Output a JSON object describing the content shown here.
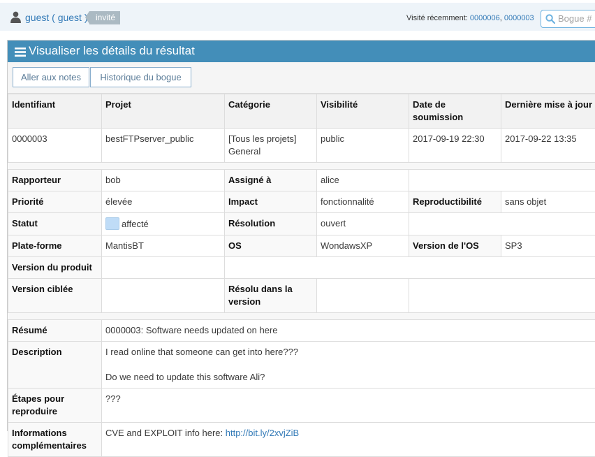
{
  "navbar": {
    "user_label": "guest ( guest )",
    "role_badge": "invité",
    "recent_label": "Visité récemment:",
    "recent_links": [
      "0000006",
      "0000003"
    ],
    "search_placeholder": "Bogue #"
  },
  "widget": {
    "title": "Visualiser les détails du résultat",
    "buttons": {
      "notes": "Aller aux notes",
      "history": "Historique du bogue"
    }
  },
  "summary_table": {
    "headers": [
      "Identifiant",
      "Projet",
      "Catégorie",
      "Visibilité",
      "Date de soumission",
      "Dernière mise à jour"
    ],
    "row": {
      "id": "0000003",
      "project": "bestFTPserver_public",
      "category_line1": "[Tous les projets]",
      "category_line2": "General",
      "visibility": "public",
      "submitted": "2017-09-19 22:30",
      "updated": "2017-09-22 13:35"
    }
  },
  "fields": {
    "reporter_label": "Rapporteur",
    "reporter": "bob",
    "assigned_label": "Assigné à",
    "assigned": "alice",
    "priority_label": "Priorité",
    "priority": "élevée",
    "impact_label": "Impact",
    "impact": "fonctionnalité",
    "reproducibility_label": "Reproductibilité",
    "reproducibility": "sans objet",
    "status_label": "Statut",
    "status": "affecté",
    "status_color": "#bfdcf7",
    "resolution_label": "Résolution",
    "resolution": "ouvert",
    "platform_label": "Plate-forme",
    "platform": "MantisBT",
    "os_label": "OS",
    "os": "WondawsXP",
    "os_version_label": "Version de l'OS",
    "os_version": "SP3",
    "product_version_label": "Version du produit",
    "target_version_label": "Version ciblée",
    "fixed_in_label": "Résolu dans la version"
  },
  "text_fields": {
    "summary_label": "Résumé",
    "summary": "0000003: Software needs updated on here",
    "description_label": "Description",
    "description_line1": "I read online that someone can get into here???",
    "description_line2": "Do we need to update this software Ali?",
    "steps_label": "Étapes pour reproduire",
    "steps": "???",
    "info_label": "Informations complémentaires",
    "info_text": "CVE and EXPLOIT info here: ",
    "info_link": "http://bit.ly/2xvjZiB"
  },
  "colors": {
    "header_blue": "#438eb9",
    "link_blue": "#337ab7",
    "badge_grey": "#abbac3"
  }
}
